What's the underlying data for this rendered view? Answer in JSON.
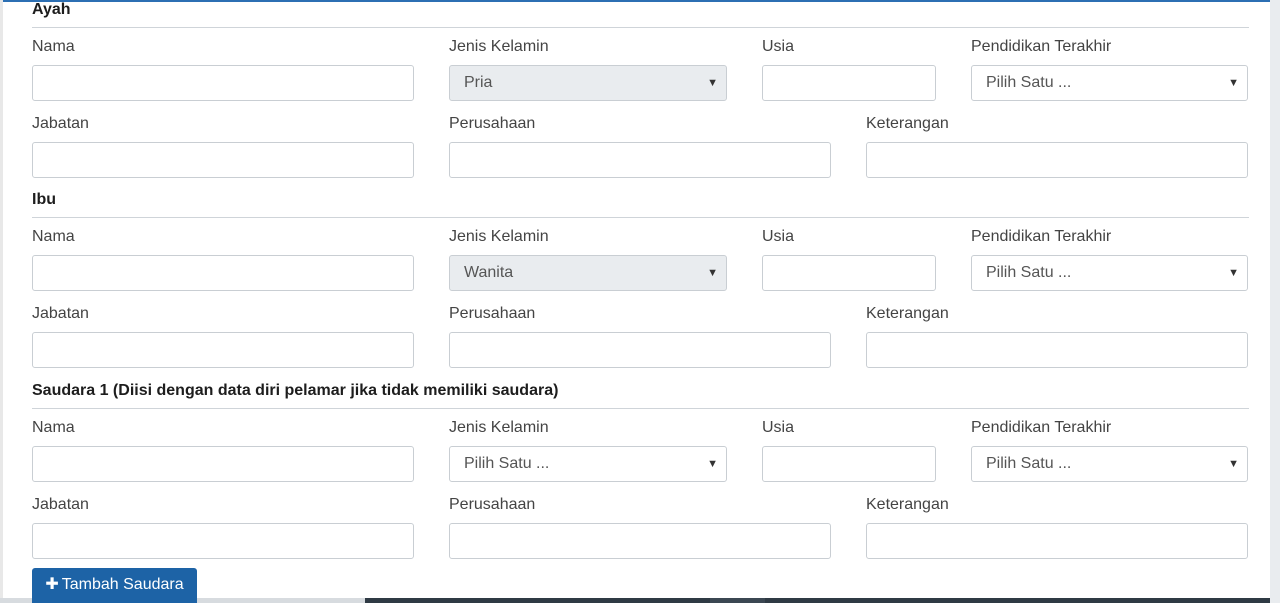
{
  "labels": {
    "nama": "Nama",
    "jenis_kelamin": "Jenis Kelamin",
    "usia": "Usia",
    "pendidikan": "Pendidikan Terakhir",
    "jabatan": "Jabatan",
    "perusahaan": "Perusahaan",
    "keterangan": "Keterangan"
  },
  "sections": [
    {
      "title": "Ayah",
      "jenis_kelamin_value": "Pria",
      "pendidikan_value": "Pilih Satu ..."
    },
    {
      "title": "Ibu",
      "jenis_kelamin_value": "Wanita",
      "pendidikan_value": "Pilih Satu ..."
    },
    {
      "title": "Saudara 1 (Diisi dengan data diri pelamar jika tidak memiliki saudara)",
      "jenis_kelamin_value": "Pilih Satu ...",
      "pendidikan_value": "Pilih Satu ..."
    }
  ],
  "icons": {
    "select_arrow": "▼",
    "plus": "✚"
  },
  "actions": {
    "add_sibling": "Tambah Saudara"
  },
  "colors": {
    "accent": "#1d63a6",
    "disabled_bg": "#e9ecef"
  }
}
